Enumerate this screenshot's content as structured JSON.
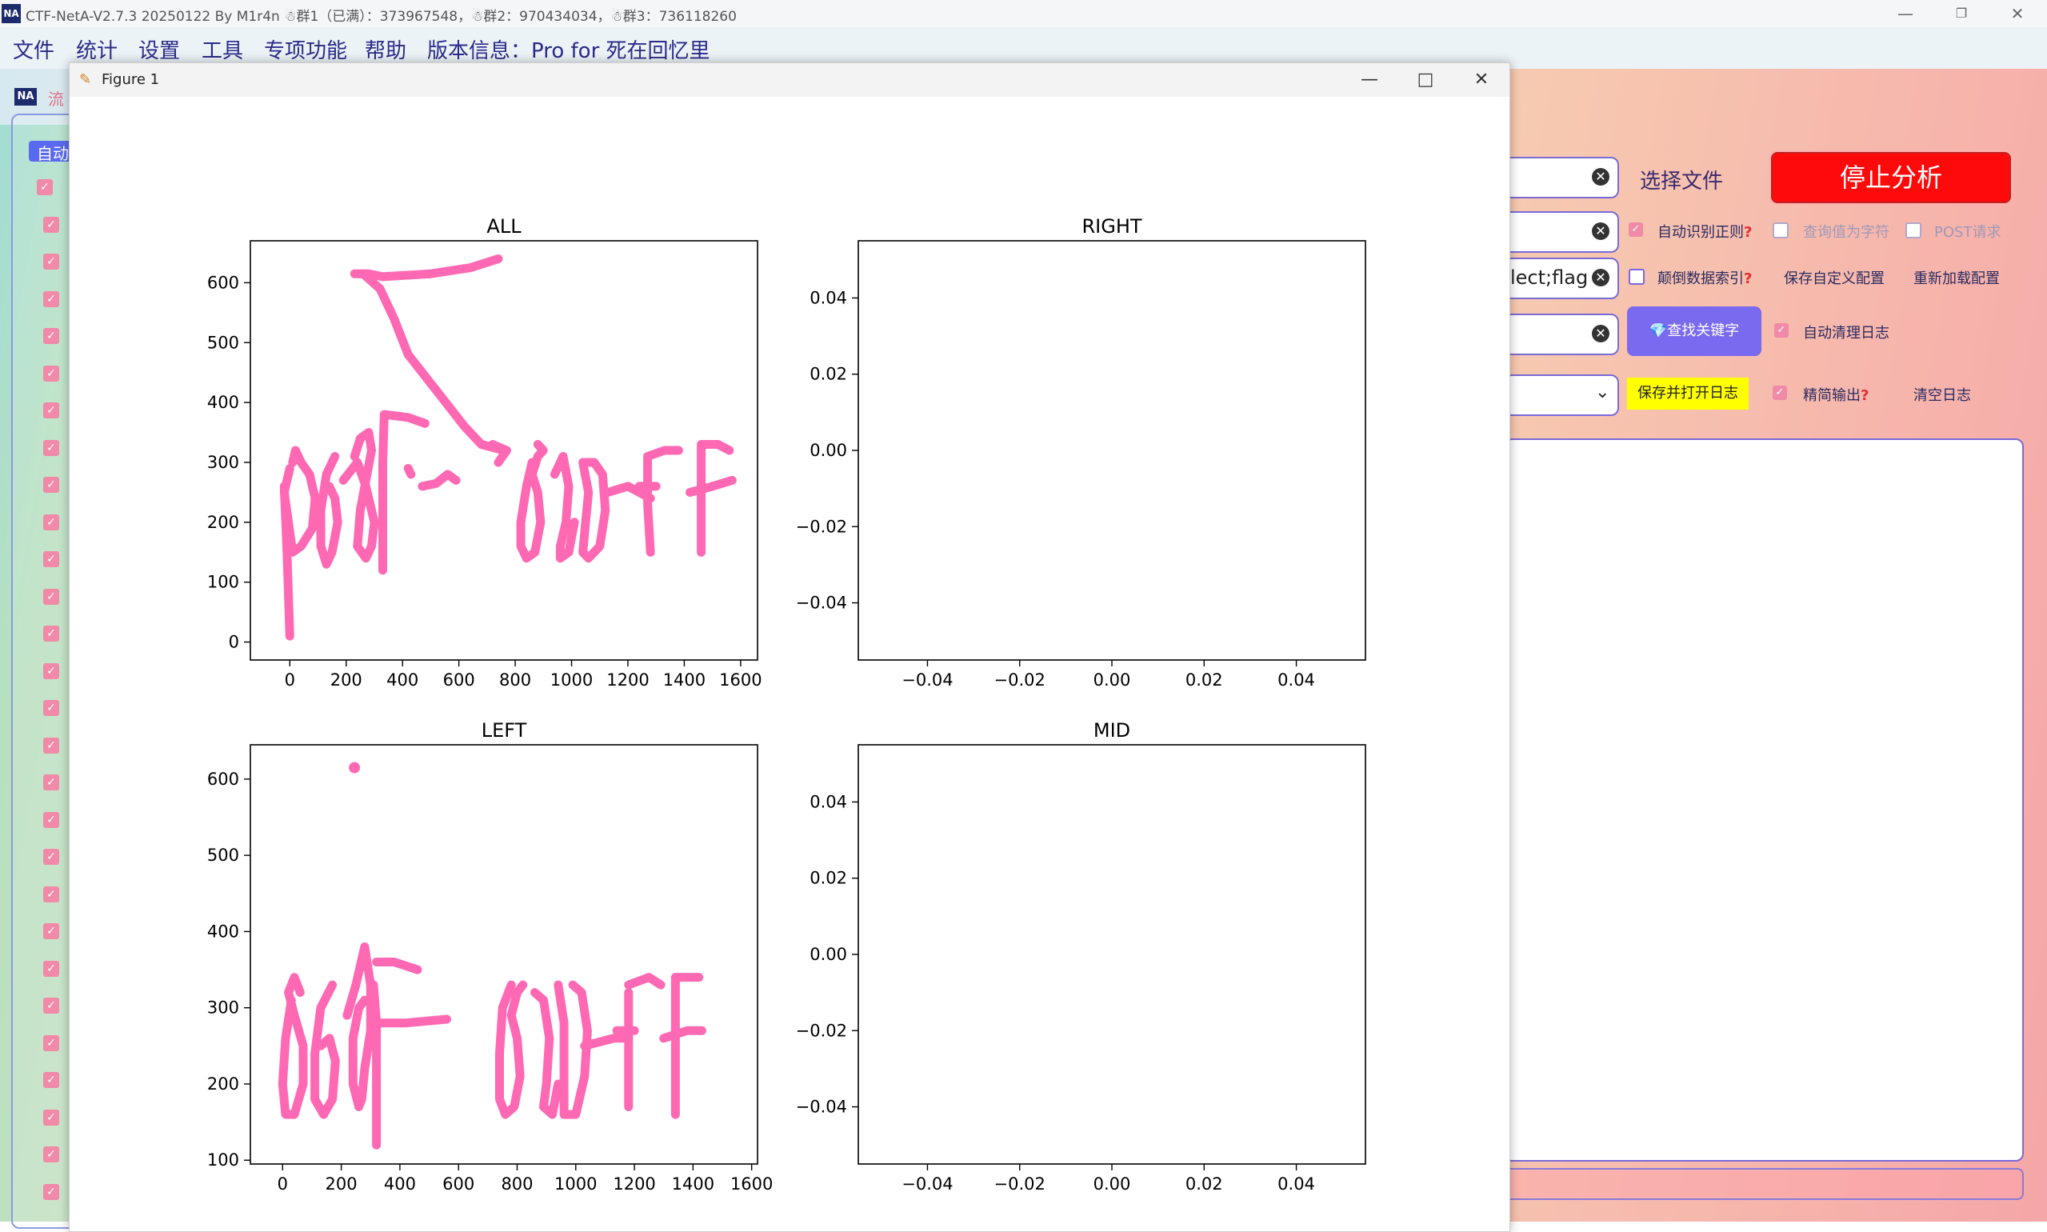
{
  "main_window": {
    "logo": "NA",
    "title": "CTF-NetA-V2.7.3 20250122 By M1r4n ☃群1（已满）：373967548，☃群2：970434034，☃群3：736118260",
    "controls": {
      "minimize": "—",
      "restore": "❐",
      "close": "✕"
    },
    "menu": [
      "文件",
      "统计",
      "设置",
      "工具",
      "专项功能",
      "帮助",
      "版本信息：Pro for 死在回忆里"
    ],
    "sub_logo": "NA",
    "flow_tab": "流",
    "auto_tab": "自动",
    "left_checks_count_label": "",
    "filter_value": "lect;flag",
    "select_file_label": "选择文件",
    "stop_button": "停止分析",
    "options": {
      "auto_regex": "自动识别正则",
      "query_as_char": "查询值为字符",
      "post_request": "POST请求",
      "reverse_index": "颠倒数据索引",
      "save_config": "保存自定义配置",
      "reload_config": "重新加载配置",
      "find_keyword": "查找关键字",
      "auto_clear_log": "自动清理日志",
      "save_open_log": "保存并打开日志",
      "concise_output": "精简输出",
      "clear_log": "清空日志",
      "help_mark": "?"
    }
  },
  "figure_window": {
    "title": "Figure 1",
    "controls": {
      "minimize": "—",
      "maximize": "□",
      "close": "✕"
    }
  },
  "chart_data": [
    {
      "type": "scatter",
      "title": "ALL",
      "xlim": [
        -140,
        1660
      ],
      "ylim": [
        -30,
        670
      ],
      "xticks": [
        "0",
        "200",
        "400",
        "600",
        "800",
        "1000",
        "1200",
        "1400",
        "1600"
      ],
      "xtick_values": [
        0,
        200,
        400,
        600,
        800,
        1000,
        1200,
        1400,
        1600
      ],
      "yticks": [
        "0",
        "100",
        "200",
        "300",
        "400",
        "500",
        "600"
      ],
      "ytick_values": [
        0,
        100,
        200,
        300,
        400,
        500,
        600
      ],
      "series_color": "#ff69b4",
      "strokes": [
        [
          [
            230,
            615
          ],
          [
            280,
            615
          ],
          [
            330,
            610
          ],
          [
            500,
            615
          ],
          [
            640,
            625
          ],
          [
            740,
            640
          ]
        ],
        [
          [
            260,
            615
          ],
          [
            320,
            590
          ],
          [
            370,
            540
          ],
          [
            420,
            480
          ],
          [
            520,
            420
          ],
          [
            620,
            360
          ],
          [
            680,
            330
          ],
          [
            760,
            320
          ]
        ],
        [
          [
            0,
            290
          ],
          [
            -20,
            250
          ],
          [
            -5,
            200
          ],
          [
            10,
            150
          ],
          [
            40,
            160
          ],
          [
            80,
            190
          ],
          [
            90,
            240
          ],
          [
            70,
            280
          ],
          [
            40,
            300
          ],
          [
            20,
            320
          ],
          [
            10,
            300
          ]
        ],
        [
          [
            0,
            10
          ],
          [
            -10,
            150
          ],
          [
            -20,
            260
          ]
        ],
        [
          [
            160,
            310
          ],
          [
            130,
            280
          ],
          [
            110,
            220
          ],
          [
            110,
            160
          ],
          [
            130,
            130
          ],
          [
            150,
            150
          ],
          [
            170,
            200
          ],
          [
            160,
            240
          ],
          [
            140,
            260
          ],
          [
            120,
            250
          ]
        ],
        [
          [
            190,
            270
          ],
          [
            240,
            300
          ],
          [
            270,
            260
          ],
          [
            300,
            200
          ],
          [
            290,
            160
          ],
          [
            270,
            140
          ],
          [
            240,
            160
          ],
          [
            250,
            220
          ],
          [
            270,
            270
          ],
          [
            290,
            320
          ],
          [
            280,
            350
          ],
          [
            250,
            340
          ],
          [
            230,
            310
          ]
        ],
        [
          [
            330,
            120
          ],
          [
            330,
            200
          ],
          [
            330,
            300
          ],
          [
            335,
            380
          ],
          [
            420,
            375
          ],
          [
            480,
            365
          ]
        ],
        [
          [
            420,
            290
          ],
          [
            430,
            280
          ]
        ],
        [
          [
            470,
            260
          ],
          [
            520,
            265
          ],
          [
            560,
            280
          ],
          [
            590,
            270
          ]
        ],
        [
          [
            740,
            300
          ],
          [
            770,
            320
          ],
          [
            720,
            330
          ]
        ],
        [
          [
            860,
            300
          ],
          [
            840,
            260
          ],
          [
            820,
            200
          ],
          [
            820,
            160
          ],
          [
            840,
            140
          ],
          [
            870,
            150
          ],
          [
            890,
            200
          ],
          [
            880,
            250
          ],
          [
            860,
            280
          ],
          [
            880,
            310
          ],
          [
            900,
            320
          ],
          [
            880,
            330
          ]
        ],
        [
          [
            940,
            280
          ],
          [
            970,
            310
          ],
          [
            990,
            260
          ],
          [
            980,
            200
          ],
          [
            960,
            160
          ],
          [
            960,
            140
          ],
          [
            990,
            150
          ],
          [
            1010,
            200
          ]
        ],
        [
          [
            1040,
            300
          ],
          [
            1060,
            250
          ],
          [
            1050,
            200
          ],
          [
            1040,
            150
          ],
          [
            1060,
            140
          ],
          [
            1100,
            160
          ],
          [
            1120,
            220
          ],
          [
            1110,
            280
          ],
          [
            1080,
            300
          ],
          [
            1050,
            300
          ]
        ],
        [
          [
            1130,
            250
          ],
          [
            1200,
            260
          ],
          [
            1240,
            250
          ],
          [
            1280,
            240
          ]
        ],
        [
          [
            1280,
            150
          ],
          [
            1270,
            230
          ],
          [
            1270,
            310
          ],
          [
            1330,
            320
          ],
          [
            1380,
            320
          ]
        ],
        [
          [
            1240,
            260
          ],
          [
            1300,
            260
          ]
        ],
        [
          [
            1460,
            150
          ],
          [
            1460,
            250
          ],
          [
            1460,
            330
          ],
          [
            1520,
            330
          ],
          [
            1560,
            320
          ]
        ],
        [
          [
            1420,
            250
          ],
          [
            1500,
            260
          ],
          [
            1570,
            270
          ]
        ]
      ]
    },
    {
      "type": "scatter",
      "title": "RIGHT",
      "xlim": [
        -0.055,
        0.055
      ],
      "ylim": [
        -0.055,
        0.055
      ],
      "xticks": [
        "−0.04",
        "−0.02",
        "0.00",
        "0.02",
        "0.04"
      ],
      "xtick_values": [
        -0.04,
        -0.02,
        0.0,
        0.02,
        0.04
      ],
      "yticks": [
        "−0.04",
        "−0.02",
        "0.00",
        "0.02",
        "0.04"
      ],
      "ytick_values": [
        -0.04,
        -0.02,
        0.0,
        0.02,
        0.04
      ],
      "strokes": []
    },
    {
      "type": "scatter",
      "title": "LEFT",
      "xlim": [
        -110,
        1620
      ],
      "ylim": [
        95,
        645
      ],
      "xticks": [
        "0",
        "200",
        "400",
        "600",
        "800",
        "1000",
        "1200",
        "1400",
        "1600"
      ],
      "xtick_values": [
        0,
        200,
        400,
        600,
        800,
        1000,
        1200,
        1400,
        1600
      ],
      "yticks": [
        "100",
        "200",
        "300",
        "400",
        "500",
        "600"
      ],
      "ytick_values": [
        100,
        200,
        300,
        400,
        500,
        600
      ],
      "series_color": "#ff69b4",
      "points": [
        [
          245,
          615
        ]
      ],
      "strokes": [
        [
          [
            30,
            310
          ],
          [
            10,
            260
          ],
          [
            0,
            200
          ],
          [
            10,
            160
          ],
          [
            40,
            160
          ],
          [
            70,
            200
          ],
          [
            70,
            250
          ],
          [
            40,
            290
          ],
          [
            20,
            320
          ],
          [
            40,
            340
          ],
          [
            60,
            320
          ]
        ],
        [
          [
            170,
            330
          ],
          [
            130,
            300
          ],
          [
            110,
            240
          ],
          [
            110,
            180
          ],
          [
            140,
            160
          ],
          [
            170,
            180
          ],
          [
            180,
            230
          ],
          [
            160,
            260
          ],
          [
            130,
            250
          ]
        ],
        [
          [
            220,
            290
          ],
          [
            250,
            330
          ],
          [
            280,
            380
          ],
          [
            300,
            330
          ],
          [
            300,
            270
          ],
          [
            280,
            220
          ],
          [
            270,
            180
          ],
          [
            260,
            170
          ],
          [
            240,
            200
          ],
          [
            240,
            260
          ],
          [
            260,
            300
          ],
          [
            280,
            310
          ]
        ],
        [
          [
            310,
            330
          ],
          [
            320,
            280
          ],
          [
            320,
            200
          ],
          [
            320,
            120
          ]
        ],
        [
          [
            320,
            360
          ],
          [
            380,
            360
          ],
          [
            460,
            350
          ]
        ],
        [
          [
            330,
            280
          ],
          [
            420,
            280
          ],
          [
            560,
            285
          ]
        ],
        [
          [
            780,
            330
          ],
          [
            750,
            300
          ],
          [
            740,
            240
          ],
          [
            740,
            180
          ],
          [
            760,
            160
          ],
          [
            790,
            170
          ],
          [
            810,
            210
          ],
          [
            800,
            260
          ],
          [
            780,
            290
          ],
          [
            800,
            320
          ],
          [
            820,
            330
          ]
        ],
        [
          [
            860,
            320
          ],
          [
            890,
            310
          ],
          [
            910,
            260
          ],
          [
            900,
            200
          ],
          [
            890,
            170
          ],
          [
            920,
            160
          ],
          [
            940,
            200
          ]
        ],
        [
          [
            940,
            330
          ],
          [
            960,
            280
          ],
          [
            960,
            200
          ],
          [
            960,
            160
          ],
          [
            1000,
            160
          ],
          [
            1030,
            210
          ],
          [
            1040,
            270
          ],
          [
            1020,
            320
          ],
          [
            990,
            330
          ]
        ],
        [
          [
            1030,
            250
          ],
          [
            1130,
            260
          ],
          [
            1180,
            260
          ]
        ],
        [
          [
            1180,
            320
          ],
          [
            1180,
            230
          ],
          [
            1180,
            170
          ]
        ],
        [
          [
            1180,
            330
          ],
          [
            1250,
            340
          ],
          [
            1290,
            330
          ]
        ],
        [
          [
            1140,
            270
          ],
          [
            1200,
            270
          ]
        ],
        [
          [
            1340,
            160
          ],
          [
            1340,
            260
          ],
          [
            1340,
            340
          ],
          [
            1400,
            340
          ],
          [
            1420,
            340
          ]
        ],
        [
          [
            1300,
            260
          ],
          [
            1380,
            270
          ],
          [
            1430,
            270
          ]
        ]
      ]
    },
    {
      "type": "scatter",
      "title": "MID",
      "xlim": [
        -0.055,
        0.055
      ],
      "ylim": [
        -0.055,
        0.055
      ],
      "xticks": [
        "−0.04",
        "−0.02",
        "0.00",
        "0.02",
        "0.04"
      ],
      "xtick_values": [
        -0.04,
        -0.02,
        0.0,
        0.02,
        0.04
      ],
      "yticks": [
        "−0.04",
        "−0.02",
        "0.00",
        "0.02",
        "0.04"
      ],
      "ytick_values": [
        -0.04,
        -0.02,
        0.0,
        0.02,
        0.04
      ],
      "strokes": []
    }
  ]
}
